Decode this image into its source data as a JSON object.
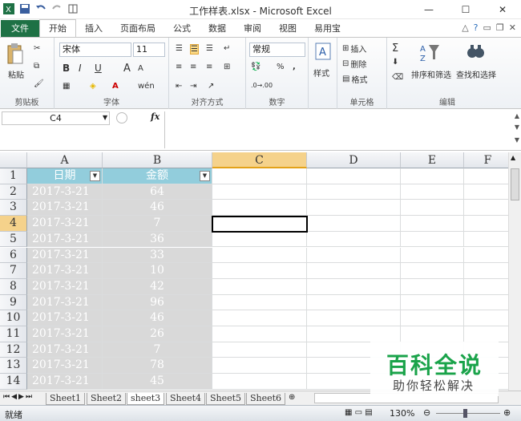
{
  "window": {
    "title": "工作样表.xlsx - Microsoft Excel",
    "minimize": "—",
    "maximize": "☐",
    "close": "✕"
  },
  "ribbon_tabs": {
    "file": "文件",
    "items": [
      "开始",
      "插入",
      "页面布局",
      "公式",
      "数据",
      "审阅",
      "视图",
      "易用宝"
    ],
    "active": "开始"
  },
  "ribbon": {
    "clipboard": {
      "paste": "粘贴",
      "label": "剪贴板"
    },
    "font": {
      "name": "宋体",
      "size": "11",
      "bold": "B",
      "italic": "I",
      "underline": "U",
      "grow": "A",
      "shrink": "A",
      "wen": "wén",
      "label": "字体"
    },
    "alignment": {
      "label": "对齐方式"
    },
    "number": {
      "format": "常规",
      "percent": "%",
      "comma": ",",
      "label": "数字"
    },
    "styles": {
      "style": "样式"
    },
    "cells": {
      "insert": "插入",
      "delete": "删除",
      "format": "格式",
      "label": "单元格"
    },
    "editing": {
      "sigma": "Σ",
      "sort": "排序和筛选",
      "find": "查找和选择",
      "label": "编辑"
    }
  },
  "formula_bar": {
    "name_box": "C4",
    "fx": "fx",
    "content": ""
  },
  "columns": [
    "A",
    "B",
    "C",
    "D",
    "E",
    "F"
  ],
  "selected_column": "C",
  "rows": [
    "1",
    "2",
    "3",
    "4",
    "5",
    "6",
    "7",
    "8",
    "9",
    "10",
    "11",
    "12",
    "13",
    "14"
  ],
  "selected_row": "4",
  "table": {
    "headers": [
      "日期",
      "金额"
    ],
    "data": [
      [
        "2017-3-21",
        "64"
      ],
      [
        "2017-3-21",
        "46"
      ],
      [
        "2017-3-21",
        "7"
      ],
      [
        "2017-3-21",
        "36"
      ],
      [
        "2017-3-21",
        "33"
      ],
      [
        "2017-3-21",
        "10"
      ],
      [
        "2017-3-21",
        "42"
      ],
      [
        "2017-3-21",
        "96"
      ],
      [
        "2017-3-21",
        "46"
      ],
      [
        "2017-3-21",
        "26"
      ],
      [
        "2017-3-21",
        "7"
      ],
      [
        "2017-3-21",
        "78"
      ],
      [
        "2017-3-21",
        "45"
      ]
    ]
  },
  "sheets": [
    "Sheet1",
    "Sheet2",
    "sheet3",
    "Sheet4",
    "Sheet5",
    "Sheet6"
  ],
  "active_sheet": "sheet3",
  "status": {
    "mode": "就绪",
    "zoom": "130%"
  },
  "watermark": {
    "title": "百科全说",
    "subtitle": "助你轻松解决"
  },
  "colors": {
    "file_tab": "#1e7145",
    "header_fill": "#92cddc",
    "data_fill": "#d9d9d9",
    "selected_header": "#f5d28b"
  }
}
